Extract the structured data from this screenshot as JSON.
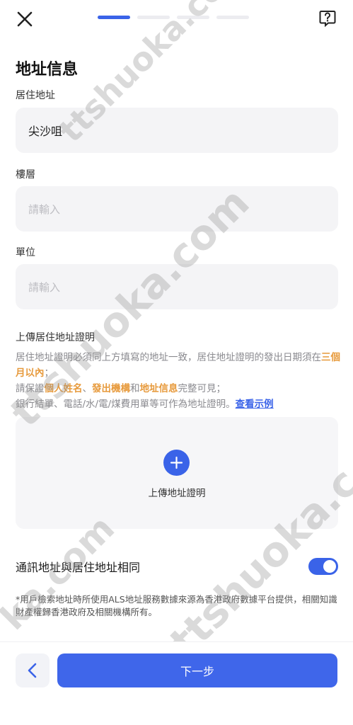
{
  "header": {
    "close_icon": "close-icon",
    "help_icon": "question-mark-icon",
    "progress": {
      "total_steps": 4,
      "current_step": 1
    }
  },
  "page_title": "地址信息",
  "fields": [
    {
      "label": "居住地址",
      "value": "尖沙咀",
      "placeholder": ""
    },
    {
      "label": "樓層",
      "value": "",
      "placeholder": "請輸入"
    },
    {
      "label": "單位",
      "value": "",
      "placeholder": "請輸入"
    }
  ],
  "upload": {
    "title": "上傳居住地址證明",
    "note": {
      "line1": "居住地址證明必須同上方填寫的地址一致，居住地址證明的發出日期須在",
      "line1_hl": "三個月以內",
      "line1_end": "；",
      "line2_a": "請保證",
      "line2_hl1": "個人姓名",
      "line2_sep": "、",
      "line2_hl2": "發出機構",
      "line2_and": "和",
      "line2_hl3": "地址信息",
      "line2_end": "完整可見；",
      "line3": "銀行結單、電話/水/電/煤費用單等可作為地址證明。",
      "line3_link": "查看示例"
    },
    "button_label": "上傳地址證明",
    "plus_icon": "plus-icon"
  },
  "same_address": {
    "label": "通訊地址與居住地址相同",
    "toggle_on": true
  },
  "disclaimer": "*用戶檢索地址時所使用ALS地址服務數據來源為香港政府數據平台提供，相關知識財產權歸香港政府及相關機構所有。",
  "footer": {
    "back_icon": "chevron-left-icon",
    "next_label": "下一步"
  },
  "colors": {
    "accent": "#3a63e8",
    "highlight": "#e79a3c"
  },
  "watermark": {
    "text_a": "ttshuoka.com",
    "text_b": "ttshuoka.com",
    "text_c": "ka.com",
    "text_d": "ttshuoka.c"
  }
}
